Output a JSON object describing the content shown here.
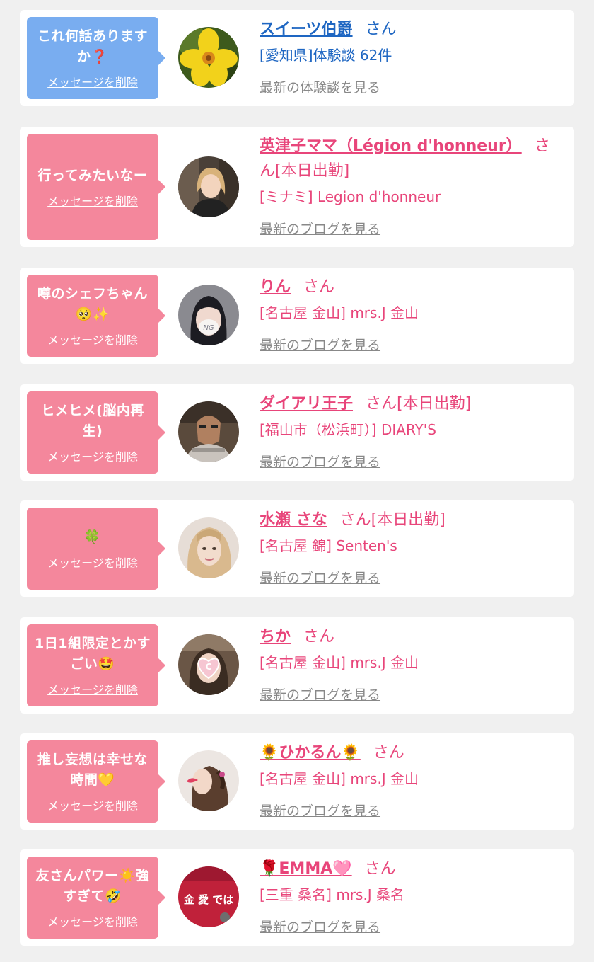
{
  "delete_label": "メッセージを削除",
  "san_label": "さん",
  "messages": [
    {
      "bubble_text": "これ何話ありますか❓",
      "name": "スイーツ伯爵",
      "suffix": "さん",
      "shop": "[愛知県]体験談 62件",
      "latest_link": "最新の体験談を見る",
      "theme": "blue"
    },
    {
      "bubble_text": "行ってみたいなー",
      "name": "英津子ママ（Légion d'honneur）",
      "suffix": "さん[本日出勤]",
      "shop": "[ミナミ] Legion d'honneur",
      "latest_link": "最新のブログを見る",
      "theme": "pink"
    },
    {
      "bubble_text": "噂のシェフちゃん🥺✨",
      "name": "りん",
      "suffix": "さん",
      "shop": "[名古屋 金山] mrs.J 金山",
      "latest_link": "最新のブログを見る",
      "theme": "pink"
    },
    {
      "bubble_text": "ヒメヒメ(脳内再生)",
      "name": "ダイアリ王子",
      "suffix": "さん[本日出勤]",
      "shop": "[福山市（松浜町）] DIARY'S",
      "latest_link": "最新のブログを見る",
      "theme": "pink"
    },
    {
      "bubble_text": "🍀",
      "name": "水瀬 さな",
      "suffix": "さん[本日出勤]",
      "shop": "[名古屋 錦] Senten's",
      "latest_link": "最新のブログを見る",
      "theme": "pink"
    },
    {
      "bubble_text": "1日1組限定とかすごい🤩",
      "name": "ちか",
      "suffix": "さん",
      "shop": "[名古屋 金山] mrs.J 金山",
      "latest_link": "最新のブログを見る",
      "theme": "pink"
    },
    {
      "bubble_text": "推し妄想は幸せな時間💛",
      "name": "🌻ひかるん🌻",
      "suffix": "さん",
      "shop": "[名古屋 金山] mrs.J 金山",
      "latest_link": "最新のブログを見る",
      "theme": "pink"
    },
    {
      "bubble_text": "友さんパワー☀️強すぎて🤣",
      "name": "🌹EMMA🩷",
      "suffix": "さん",
      "shop": "[三重 桑名] mrs.J 桑名",
      "latest_link": "最新のブログを見る",
      "theme": "pink"
    }
  ],
  "avatar_text": {
    "ng_mark": "NG",
    "heart_letter": "C",
    "shirt_text": "金 愛 では"
  },
  "colors": {
    "page_bg": "#f0f0f0",
    "card_bg": "#ffffff",
    "bubble_blue": "#79adf0",
    "bubble_pink": "#f4879c",
    "name_blue": "#1e66c2",
    "name_pink": "#e8457a",
    "link_gray": "#888888"
  }
}
